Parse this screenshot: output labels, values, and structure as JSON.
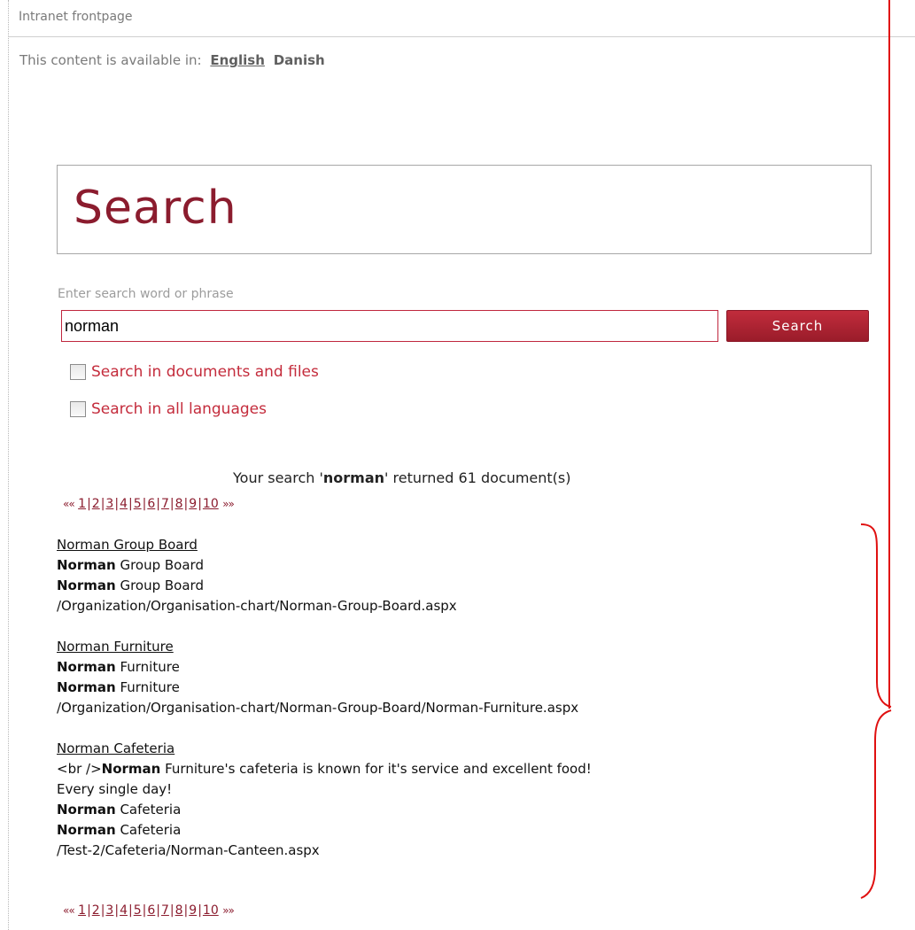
{
  "top_bar": {
    "label": "Intranet frontpage"
  },
  "languages": {
    "prefix": "This content is available in:",
    "items": [
      {
        "label": "English",
        "active": true
      },
      {
        "label": "Danish",
        "active": false
      }
    ]
  },
  "search": {
    "title": "Search",
    "hint": "Enter search word or phrase",
    "query": "norman",
    "button_label": "Search",
    "options": [
      {
        "label": "Search in documents and files",
        "checked": false
      },
      {
        "label": "Search in all languages",
        "checked": false
      }
    ]
  },
  "summary": {
    "before": "Your search '",
    "term": "norman",
    "after": "' returned 61 document(s)"
  },
  "pager": {
    "first": "««",
    "last": "»»",
    "pages": [
      "1",
      "2",
      "3",
      "4",
      "5",
      "6",
      "7",
      "8",
      "9",
      "10"
    ]
  },
  "results": [
    {
      "title": "Norman Group Board",
      "lines": [
        {
          "bold": "Norman",
          "rest": " Group Board"
        },
        {
          "bold": "Norman",
          "rest": " Group Board"
        }
      ],
      "path": "/Organization/Organisation-chart/Norman-Group-Board.aspx"
    },
    {
      "title": "Norman Furniture",
      "lines": [
        {
          "bold": "Norman",
          "rest": " Furniture"
        },
        {
          "bold": "Norman",
          "rest": " Furniture"
        }
      ],
      "path": "/Organization/Organisation-chart/Norman-Group-Board/Norman-Furniture.aspx"
    },
    {
      "title": "Norman Cafeteria",
      "lines": [
        {
          "pre": "<br />",
          "bold": "Norman",
          "rest": " Furniture's cafeteria is known for it's service and excellent food!"
        },
        {
          "rest": "Every single day!"
        },
        {
          "bold": "Norman",
          "rest": " Cafeteria"
        },
        {
          "bold": "Norman",
          "rest": " Cafeteria"
        }
      ],
      "path": "/Test-2/Cafeteria/Norman-Canteen.aspx"
    }
  ],
  "colors": {
    "brand": "#8b1c2e",
    "accent": "#c42c3c",
    "annotation": "#e01010"
  }
}
